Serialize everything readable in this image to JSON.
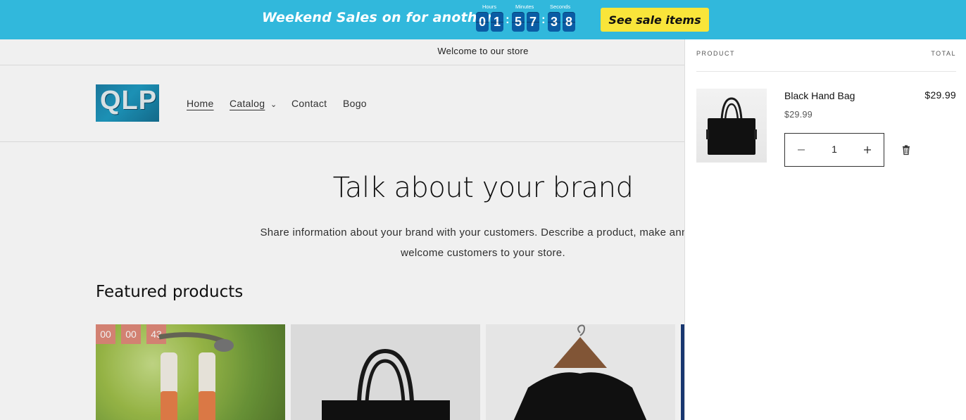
{
  "promo": {
    "title": "Weekend Sales on for another",
    "labels": {
      "hours": "Hours",
      "minutes": "Minutes",
      "seconds": "Seconds"
    },
    "digits": {
      "h1": "0",
      "h2": "1",
      "m1": "5",
      "m2": "7",
      "s1": "3",
      "s2": "8"
    },
    "separator": ":",
    "button_label": "See sale items",
    "bg_color": "#31b8dc",
    "button_color": "#f9e53a"
  },
  "store": {
    "welcome": "Welcome to our store",
    "logo_text": "QLP",
    "nav": {
      "home": "Home",
      "catalog": "Catalog",
      "contact": "Contact",
      "bogo": "Bogo"
    },
    "hero_title": "Talk about your brand",
    "hero_line1": "Share information about your brand with your customers. Describe a product, make announ",
    "hero_line2": "welcome customers to your store.",
    "featured_title": "Featured products",
    "product_countdown": {
      "hours": "00",
      "minutes": "00",
      "seconds": "43"
    }
  },
  "cart": {
    "col_product": "PRODUCT",
    "col_total": "TOTAL",
    "item": {
      "name": "Black Hand Bag",
      "price": "$29.99",
      "total": "$29.99",
      "quantity": "1"
    },
    "icons": {
      "minus": "minus-icon",
      "plus": "plus-icon",
      "remove": "trash-icon"
    }
  }
}
